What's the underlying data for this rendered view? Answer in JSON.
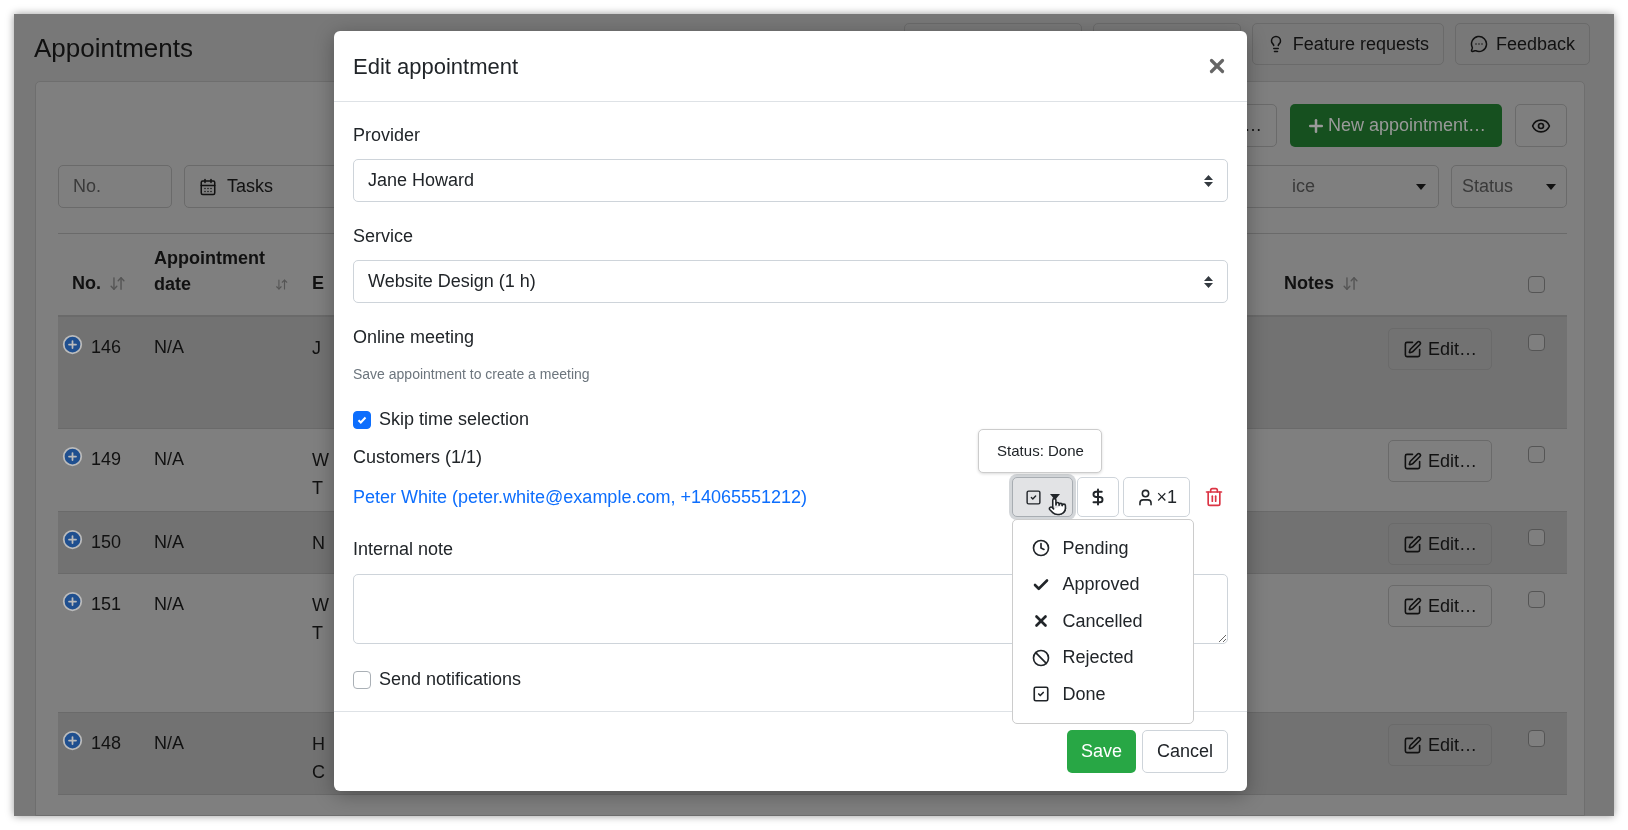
{
  "page": {
    "title": "Appointments",
    "header_buttons": [
      {
        "label": "Feature requests",
        "kind": "idea"
      },
      {
        "label": "Feedback",
        "kind": "comment"
      }
    ]
  },
  "toolbar": {
    "cut_button": "…",
    "new_button": "New appointment…"
  },
  "filters": {
    "number_placeholder": "No.",
    "tasks": "Tasks",
    "service_cut": "ice",
    "status": "Status"
  },
  "table": {
    "columns": [
      "No.",
      "Appointment date",
      "E",
      "Notes"
    ],
    "header_checked": false,
    "rows": [
      {
        "no": "146",
        "date": "N/A",
        "column_3": [
          "J"
        ],
        "edit": "Edit…",
        "checked": false
      },
      {
        "no": "149",
        "date": "N/A",
        "column_3": [
          "W",
          "T"
        ],
        "edit": "Edit…",
        "checked": false
      },
      {
        "no": "150",
        "date": "N/A",
        "column_3": [
          "N"
        ],
        "edit": "Edit…",
        "checked": false
      },
      {
        "no": "151",
        "date": "N/A",
        "column_3": [
          "W",
          "T"
        ],
        "edit": "Edit…",
        "checked": false
      },
      {
        "no": "148",
        "date": "N/A",
        "column_3": [
          "H",
          "C"
        ],
        "edit": "Edit…",
        "checked": false
      }
    ]
  },
  "modal": {
    "title": "Edit appointment",
    "provider": {
      "label": "Provider",
      "value": "Jane Howard"
    },
    "service": {
      "label": "Service",
      "value": "Website Design (1 h)"
    },
    "online_meeting": {
      "label": "Online meeting",
      "hint": "Save appointment to create a meeting"
    },
    "skip_time": {
      "label": "Skip time selection",
      "checked": true
    },
    "customers": {
      "label": "Customers (1/1)",
      "items": [
        {
          "name": "Peter White (peter.white@example.com, +14065551212)",
          "tooltip": "Status: Done",
          "count": "×1",
          "menu_expanded": true,
          "status_menu": [
            {
              "label": "Pending",
              "kind": "clock"
            },
            {
              "label": "Approved",
              "kind": "check"
            },
            {
              "label": "Cancelled",
              "kind": "cross"
            },
            {
              "label": "Rejected",
              "kind": "ban"
            },
            {
              "label": "Done",
              "kind": "done"
            }
          ]
        }
      ]
    },
    "internal_note": {
      "label": "Internal note"
    },
    "send_notifications": {
      "label": "Send notifications",
      "checked": false
    },
    "buttons": [
      {
        "label": "Save",
        "kind": "primary"
      },
      {
        "label": "Cancel",
        "kind": "secondary"
      }
    ]
  }
}
